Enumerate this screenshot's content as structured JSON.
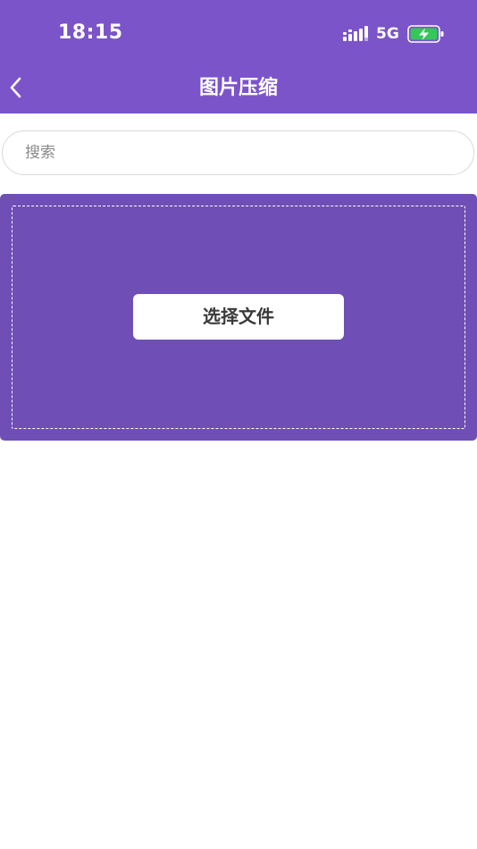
{
  "status_bar": {
    "time": "18:15",
    "network": "5G",
    "signal_icon": "signal-bars-icon",
    "battery_icon": "battery-charging-icon",
    "battery_color": "#34c759"
  },
  "nav": {
    "back_icon": "chevron-left-icon",
    "title": "图片压缩"
  },
  "search": {
    "placeholder": "搜索",
    "value": ""
  },
  "upload": {
    "button_label": "选择文件"
  },
  "colors": {
    "header_bg": "#7b54c9",
    "panel_bg": "#6f4fb6",
    "text_on_accent": "#ffffff"
  }
}
